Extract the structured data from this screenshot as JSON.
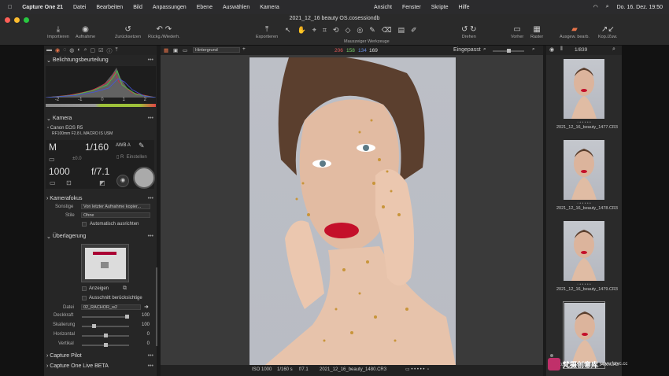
{
  "menubar": {
    "app": "Capture One 21",
    "items": [
      "Datei",
      "Bearbeiten",
      "Bild",
      "Anpassungen",
      "Ebene",
      "Auswählen",
      "Kamera"
    ],
    "right_items": [
      "Ansicht",
      "Fenster",
      "Skripte",
      "Hilfe"
    ],
    "clock": "Do. 16. Dez.  19:50"
  },
  "window": {
    "title": "2021_12_16 beauty OS.cosessiondb"
  },
  "toolbar": {
    "import": "Importieren",
    "capture": "Aufnahme",
    "reset": "Zurücksetzen",
    "undo": "Rückg./Wiederh.",
    "export": "Exportieren",
    "cursor_tools": "Mauszeiger Werkzeuge",
    "rotate": "Drehen",
    "before": "Vorher",
    "grid": "Raster",
    "accent": "Ausgew. bearb.",
    "copy": "Kop./Zuw."
  },
  "viewer": {
    "layer": "Hintergrund",
    "rgb_r": "206",
    "rgb_g": "158",
    "rgb_b": "134",
    "rgb_l": "169",
    "zoom": "Eingepasst"
  },
  "status": {
    "iso": "ISO 1000",
    "shutter": "1/160 s",
    "aperture": "f/7.1",
    "file": "2021_12_16_beauty_1480.CR3"
  },
  "left": {
    "exposure_title": "Belichtungsbeurteilung",
    "scale": [
      "-2",
      "-1",
      "0",
      "1",
      "2"
    ],
    "camera_title": "Kamera",
    "camera_model": "Canon EOS R5",
    "lens": "RF100mm F2.8 L MACRO IS USM",
    "mode": "M",
    "shutter": "1/160",
    "awb": "AWB A",
    "ev": "±0.0",
    "iso": "1000",
    "aperture": "f/7.1",
    "settings": "Einstellen",
    "focus_title": "Kamerafokus",
    "other_label": "Sonstige",
    "other_value": "Von letzter Aufnahme kopier...",
    "styles_label": "Stile",
    "styles_value": "Ohne",
    "auto_align": "Automatisch ausrichten",
    "overlay_title": "Überlagerung",
    "show": "Anzeigen",
    "crop_label": "Ausschnitt berücksichtige",
    "file_label": "Datei",
    "file_value": "02_RACHOR_w2",
    "opacity_label": "Deckkraft",
    "opacity_value": "100",
    "scale_label": "Skalierung",
    "scale_value": "100",
    "horiz_label": "Horizontal",
    "horiz_value": "0",
    "vert_label": "Vertikal",
    "vert_value": "0",
    "pilot_title": "Capture Pilot",
    "live_title": "Capture One Live BETA"
  },
  "browser": {
    "count": "1/839",
    "thumbs": [
      "2021_12_16_beauty_1477.CR3",
      "2021_12_16_beauty_1478.CR3",
      "2021_12_16_beauty_1479.CR3",
      "2021_12_16_beauty_1480.CR3"
    ]
  },
  "watermark": {
    "text": "梵摄创意库",
    "url": "www.fstvc.cc"
  }
}
